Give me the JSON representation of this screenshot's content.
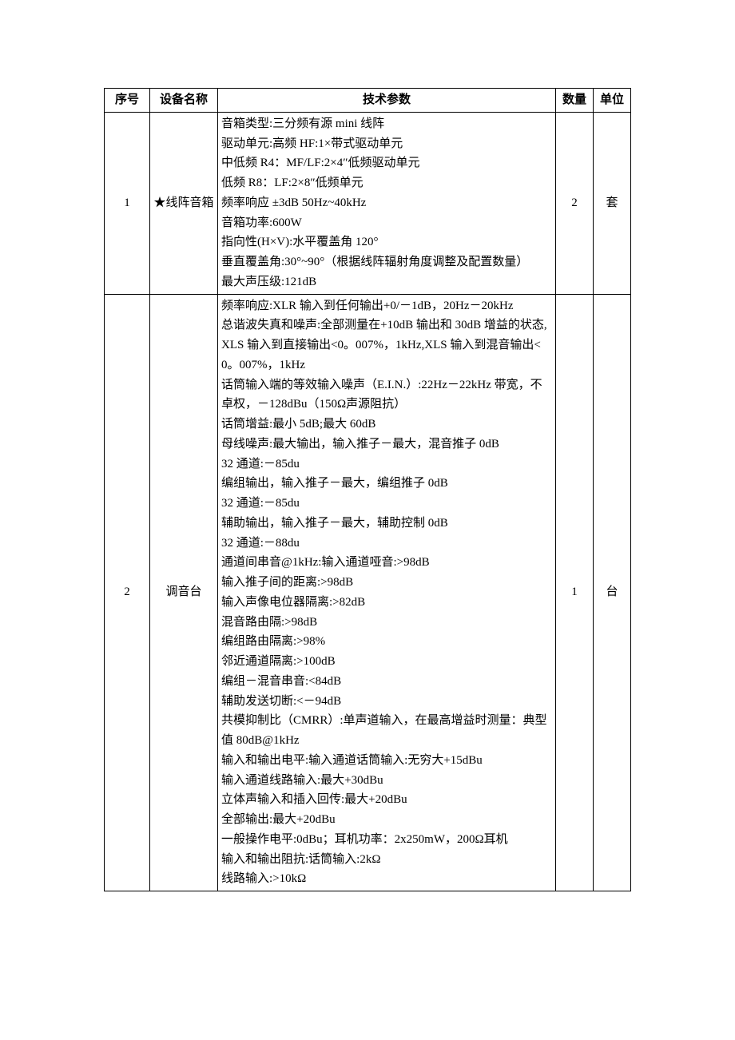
{
  "headers": {
    "index": "序号",
    "name": "设备名称",
    "spec": "技术参数",
    "qty": "数量",
    "unit": "单位"
  },
  "rows": [
    {
      "index": "1",
      "name": "★线阵音箱",
      "spec": [
        "音箱类型:三分频有源 mini 线阵",
        "驱动单元:高频 HF:1×带式驱动单元",
        "中低频 R4：MF/LF:2×4″低频驱动单元",
        "低频 R8：LF:2×8″低频单元",
        "频率响应 ±3dB 50Hz~40kHz",
        "音箱功率:600W",
        "指向性(H×V):水平覆盖角 120°",
        "垂直覆盖角:30°~90°（根据线阵辐射角度调整及配置数量）",
        "最大声压级:121dB"
      ],
      "qty": "2",
      "unit": "套"
    },
    {
      "index": "2",
      "name": "调音台",
      "spec": [
        "频率响应:XLR 输入到任何输出+0/－1dB，20Hz－20kHz",
        "总谐波失真和噪声:全部测量在+10dB 输出和 30dB 增益的状态,XLS 输入到直接输出<0。007%，1kHz,XLS 输入到混音输出<0。007%，1kHz",
        "话筒输入端的等效输入噪声（E.I.N.）:22Hz－22kHz 带宽，不卓权，－128dBu（150Ω声源阻抗）",
        "话筒增益:最小 5dB;最大 60dB",
        "母线噪声:最大输出，输入推子－最大，混音推子 0dB",
        "32 通道:－85du",
        "编组输出，输入推子－最大，编组推子 0dB",
        "32 通道:－85du",
        "辅助输出，输入推子－最大，辅助控制 0dB",
        "32 通道:－88du",
        "通道间串音@1kHz:输入通道哑音:>98dB",
        "输入推子间的距离:>98dB",
        "输入声像电位器隔离:>82dB",
        "混音路由隔:>98dB",
        "编组路由隔离:>98%",
        "邻近通道隔离:>100dB",
        "编组－混音串音:<84dB",
        "辅助发送切断:<－94dB",
        "共模抑制比（CMRR）:单声道输入，在最高增益时测量：典型值 80dB@1kHz",
        "输入和输出电平:输入通道话筒输入:无穷大+15dBu",
        "输入通道线路输入:最大+30dBu",
        "立体声输入和插入回传:最大+20dBu",
        "全部输出:最大+20dBu",
        "一般操作电平:0dBu；耳机功率：2x250mW，200Ω耳机",
        "输入和输出阻抗:话筒输入:2kΩ",
        "线路输入:>10kΩ"
      ],
      "qty": "1",
      "unit": "台"
    }
  ]
}
